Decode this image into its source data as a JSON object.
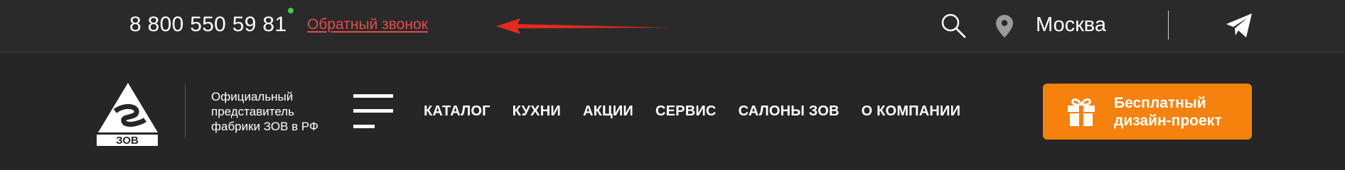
{
  "topbar": {
    "phone": "8 800 550 59 81",
    "callback_label": "Обратный звонок",
    "city": "Москва",
    "icons": {
      "search": "search-icon",
      "location": "map-pin-icon",
      "messenger": "telegram-icon",
      "status": "online-dot"
    },
    "colors": {
      "callback": "#e24b4b",
      "online": "#4cc84a",
      "arrow": "#e32b1e"
    }
  },
  "header": {
    "logo_text": "ЗОВ",
    "tagline_lines": [
      "Официальный",
      "представитель",
      "фабрики ЗОВ в РФ"
    ],
    "nav": [
      "КАТАЛОГ",
      "КУХНИ",
      "АКЦИИ",
      "СЕРВИС",
      "САЛОНЫ ЗОВ",
      "О КОМПАНИИ"
    ],
    "cta": {
      "line1": "Бесплатный",
      "line2": "дизайн-проект",
      "icon": "gift-icon",
      "color": "#f5820d"
    }
  }
}
